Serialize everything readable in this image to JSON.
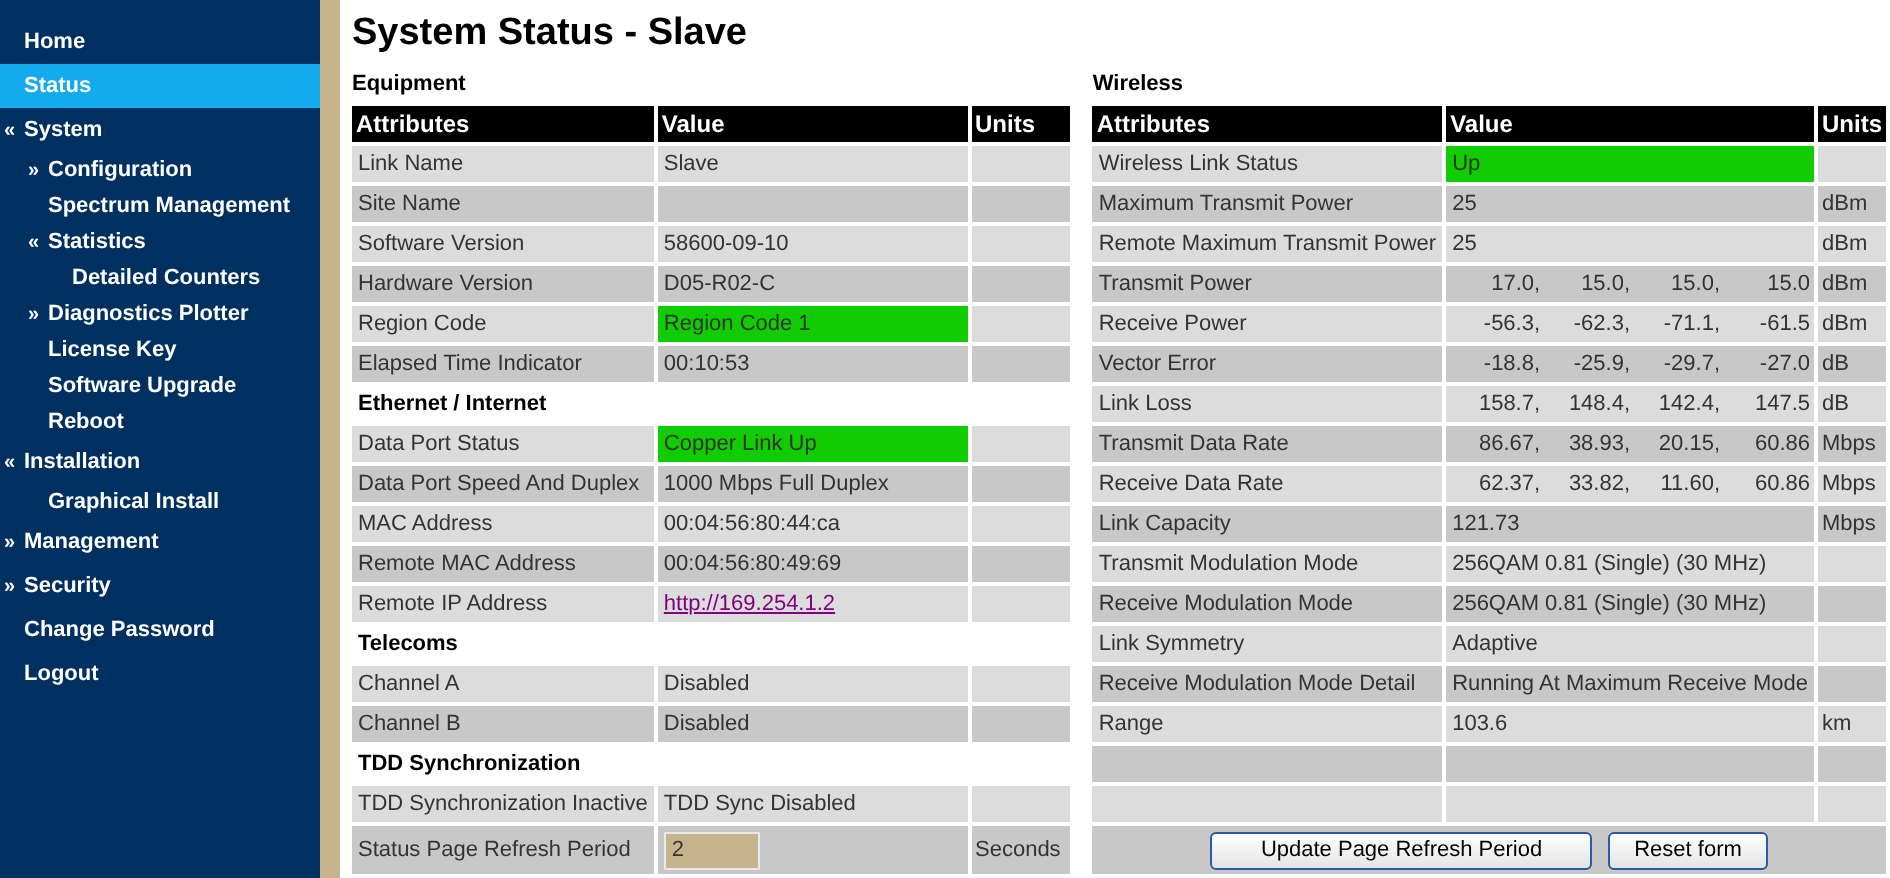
{
  "sidebar": {
    "items": [
      {
        "label": "Home",
        "selected": false
      },
      {
        "label": "Status",
        "selected": true
      },
      {
        "label": "System",
        "marker": "«",
        "selected": false,
        "children": [
          {
            "label": "Configuration",
            "marker": "»",
            "selected": false
          },
          {
            "label": "Spectrum Management",
            "selected": false
          },
          {
            "label": "Statistics",
            "marker": "«",
            "selected": false,
            "children": [
              {
                "label": "Detailed Counters",
                "selected": false
              }
            ]
          },
          {
            "label": "Diagnostics Plotter",
            "marker": "»",
            "selected": false
          },
          {
            "label": "License Key",
            "selected": false
          },
          {
            "label": "Software Upgrade",
            "selected": false
          },
          {
            "label": "Reboot",
            "selected": false
          }
        ]
      },
      {
        "label": "Installation",
        "marker": "«",
        "selected": false,
        "children": [
          {
            "label": "Graphical Install",
            "selected": false
          }
        ]
      },
      {
        "label": "Management",
        "marker": "»",
        "selected": false
      },
      {
        "label": "Security",
        "marker": "»",
        "selected": false
      },
      {
        "label": "Change Password",
        "selected": false
      },
      {
        "label": "Logout",
        "selected": false
      }
    ]
  },
  "page_title": "System Status - Slave",
  "equipment": {
    "title": "Equipment",
    "columns": [
      "Attributes",
      "Value",
      "Units"
    ],
    "sections": [
      {
        "rows": [
          {
            "attribute": "Link Name",
            "kind": "text",
            "value": "Slave",
            "highlighted": false
          },
          {
            "attribute": "Site Name",
            "kind": "text",
            "highlighted": false
          },
          {
            "attribute": "Software Version",
            "kind": "text",
            "value": "58600-09-10",
            "highlighted": false
          },
          {
            "attribute": "Hardware Version",
            "kind": "text",
            "value": "D05-R02-C",
            "highlighted": false
          },
          {
            "attribute": "Region Code",
            "kind": "text",
            "value": "Region Code 1",
            "highlighted": true
          },
          {
            "attribute": "Elapsed Time Indicator",
            "kind": "text",
            "value": "00:10:53",
            "highlighted": false
          }
        ]
      },
      {
        "heading": "Ethernet / Internet",
        "rows": [
          {
            "attribute": "Data Port Status",
            "kind": "text",
            "value": "Copper Link Up",
            "highlighted": true
          },
          {
            "attribute": "Data Port Speed And Duplex",
            "kind": "text",
            "value": "1000 Mbps Full Duplex",
            "highlighted": false
          },
          {
            "attribute": "MAC Address",
            "kind": "text",
            "value": "00:04:56:80:44:ca",
            "highlighted": false
          },
          {
            "attribute": "Remote MAC Address",
            "kind": "text",
            "value": "00:04:56:80:49:69",
            "highlighted": false
          },
          {
            "attribute": "Remote IP Address",
            "kind": "link",
            "value": "http://169.254.1.2",
            "highlighted": false
          }
        ]
      },
      {
        "heading": "Telecoms",
        "rows": [
          {
            "attribute": "Channel A",
            "kind": "text",
            "value": "Disabled",
            "highlighted": false
          },
          {
            "attribute": "Channel B",
            "kind": "text",
            "value": "Disabled",
            "highlighted": false
          }
        ]
      },
      {
        "heading": "TDD Synchronization",
        "rows": [
          {
            "attribute": "TDD Synchronization Inactive",
            "kind": "text",
            "value": "TDD Sync Disabled",
            "highlighted": false
          },
          {
            "attribute": "Status Page Refresh Period",
            "kind": "input",
            "value": "2",
            "units": "Seconds",
            "highlighted": false
          }
        ]
      }
    ]
  },
  "wireless": {
    "title": "Wireless",
    "columns": [
      "Attributes",
      "Value",
      "Units"
    ],
    "rows": [
      {
        "attribute": "Wireless Link Status",
        "kind": "text",
        "value": "Up",
        "highlighted": true
      },
      {
        "attribute": "Maximum Transmit Power",
        "kind": "text",
        "value": "25",
        "units": "dBm",
        "highlighted": false
      },
      {
        "attribute": "Remote Maximum Transmit Power",
        "kind": "text",
        "value": "25",
        "units": "dBm",
        "highlighted": false
      },
      {
        "attribute": "Transmit Power",
        "kind": "multi",
        "values": [
          "17.0,",
          "15.0,",
          "15.0,",
          "15.0"
        ],
        "units": "dBm",
        "highlighted": false
      },
      {
        "attribute": "Receive Power",
        "kind": "multi",
        "values": [
          "-56.3,",
          "-62.3,",
          "-71.1,",
          "-61.5"
        ],
        "units": "dBm",
        "highlighted": false
      },
      {
        "attribute": "Vector Error",
        "kind": "multi",
        "values": [
          "-18.8,",
          "-25.9,",
          "-29.7,",
          "-27.0"
        ],
        "units": "dB",
        "highlighted": false
      },
      {
        "attribute": "Link Loss",
        "kind": "multi",
        "values": [
          "158.7,",
          "148.4,",
          "142.4,",
          "147.5"
        ],
        "units": "dB",
        "highlighted": false
      },
      {
        "attribute": "Transmit Data Rate",
        "kind": "multi",
        "values": [
          "86.67,",
          "38.93,",
          "20.15,",
          "60.86"
        ],
        "units": "Mbps",
        "highlighted": false
      },
      {
        "attribute": "Receive Data Rate",
        "kind": "multi",
        "values": [
          "62.37,",
          "33.82,",
          "11.60,",
          "60.86"
        ],
        "units": "Mbps",
        "highlighted": false
      },
      {
        "attribute": "Link Capacity",
        "kind": "text",
        "value": "121.73",
        "units": "Mbps",
        "highlighted": false
      },
      {
        "attribute": "Transmit Modulation Mode",
        "kind": "text",
        "value": "256QAM 0.81 (Single) (30 MHz)",
        "highlighted": false
      },
      {
        "attribute": "Receive Modulation Mode",
        "kind": "text",
        "value": "256QAM 0.81 (Single) (30 MHz)",
        "highlighted": false
      },
      {
        "attribute": "Link Symmetry",
        "kind": "text",
        "value": "Adaptive",
        "highlighted": false
      },
      {
        "attribute": "Receive Modulation Mode Detail",
        "kind": "text",
        "value": "Running At Maximum Receive Mode",
        "highlighted": false
      },
      {
        "attribute": "Range",
        "kind": "text",
        "value": "103.6",
        "units": "km",
        "highlighted": false
      }
    ],
    "buttons": [
      "Update Page Refresh Period",
      "Reset form"
    ]
  }
}
